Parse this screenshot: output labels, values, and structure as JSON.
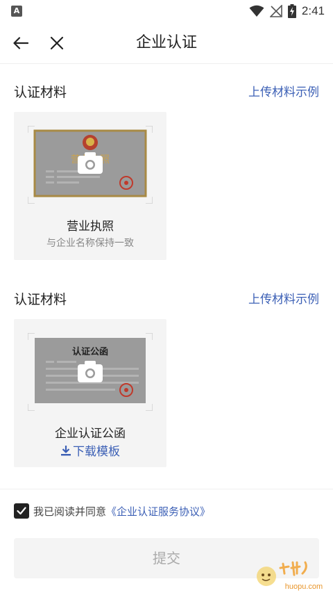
{
  "status_bar": {
    "notification_letter": "A",
    "time": "2:41",
    "icons": [
      "wifi-icon",
      "no-signal-icon",
      "battery-charging-icon"
    ]
  },
  "title_bar": {
    "title": "企业认证",
    "back_icon": "arrow-left-icon",
    "close_icon": "close-icon"
  },
  "sections": [
    {
      "title": "认证材料",
      "link": "上传材料示例",
      "card": {
        "title": "营业执照",
        "subtitle": "与企业名称保持一致",
        "image_label": "营业执照",
        "image_icon": "camera-icon"
      }
    },
    {
      "title": "认证材料",
      "link": "上传材料示例",
      "card": {
        "title": "企业认证公函",
        "download_label": "下载模板",
        "download_icon": "download-icon",
        "image_label": "认证公函",
        "image_icon": "camera-icon"
      }
    }
  ],
  "agreement": {
    "checked": true,
    "text": "我已阅读并同意",
    "link": "《企业认证服务协议》"
  },
  "submit": {
    "label": "提交"
  },
  "watermark": {
    "text": "huopu.com"
  },
  "colors": {
    "accent": "#3b5fb5",
    "card_bg": "#f4f4f4",
    "license_border": "#a88a45",
    "stamp": "#c0392b"
  }
}
